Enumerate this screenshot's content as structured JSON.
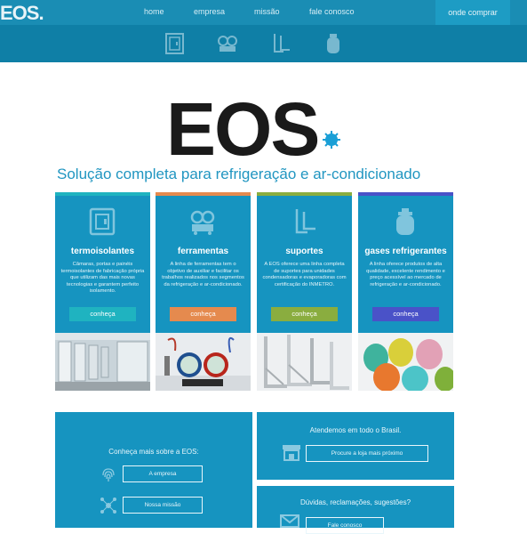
{
  "header": {
    "logo": "EOS.",
    "nav": [
      "home",
      "empresa",
      "missão",
      "fale conosco"
    ],
    "shop_label": "onde comprar"
  },
  "icon_bar": [
    "panel-icon",
    "gauges-icon",
    "bracket-icon",
    "gas-cylinder-icon"
  ],
  "hero": {
    "logo_text": "EOS",
    "tagline": "Solução completa para refrigeração e ar-condicionado"
  },
  "cards": [
    {
      "title": "termoisolantes",
      "description": "Câmaras, portas e painéis termoisolantes de fabricação própria que utilizam das mais novas tecnologias e garantem perfeito isolamento.",
      "button": "conheça",
      "accent": "#1fb3c0"
    },
    {
      "title": "ferramentas",
      "description": "A linha de ferramentas tem o objetivo de auxiliar e facilitar os trabalhos realizados nos segmentos da refrigeração e ar-condicionado.",
      "button": "conheça",
      "accent": "#e58a4e"
    },
    {
      "title": "suportes",
      "description": "A EOS oferece uma linha completa de suportes para unidades condensadoras e evaporadoras com certificação do INMETRO.",
      "button": "conheça",
      "accent": "#8aad3f"
    },
    {
      "title": "gases refrigerantes",
      "description": "A linha oferece produtos de alta qualidade, excelente rendimento e preço acessível ao mercado de refrigeração e ar-condicionado.",
      "button": "conheça",
      "accent": "#4a52c8"
    }
  ],
  "about": {
    "heading": "Conheça mais sobre a EOS:",
    "company_button": "A empresa",
    "mission_button": "Nossa missão"
  },
  "brazil": {
    "text": "Atendemos em todo o Brasil.",
    "button": "Procure a loja mais próximo"
  },
  "contact": {
    "text": "Dúvidas, reclamações, sugestões?",
    "button": "Fale conosco"
  },
  "colors": {
    "primary": "#1694c0",
    "topbar": "#1a8db4",
    "iconbar": "#0f7fa6",
    "tagline": "#2196c1",
    "hero_dot": "#1a9fd6"
  }
}
